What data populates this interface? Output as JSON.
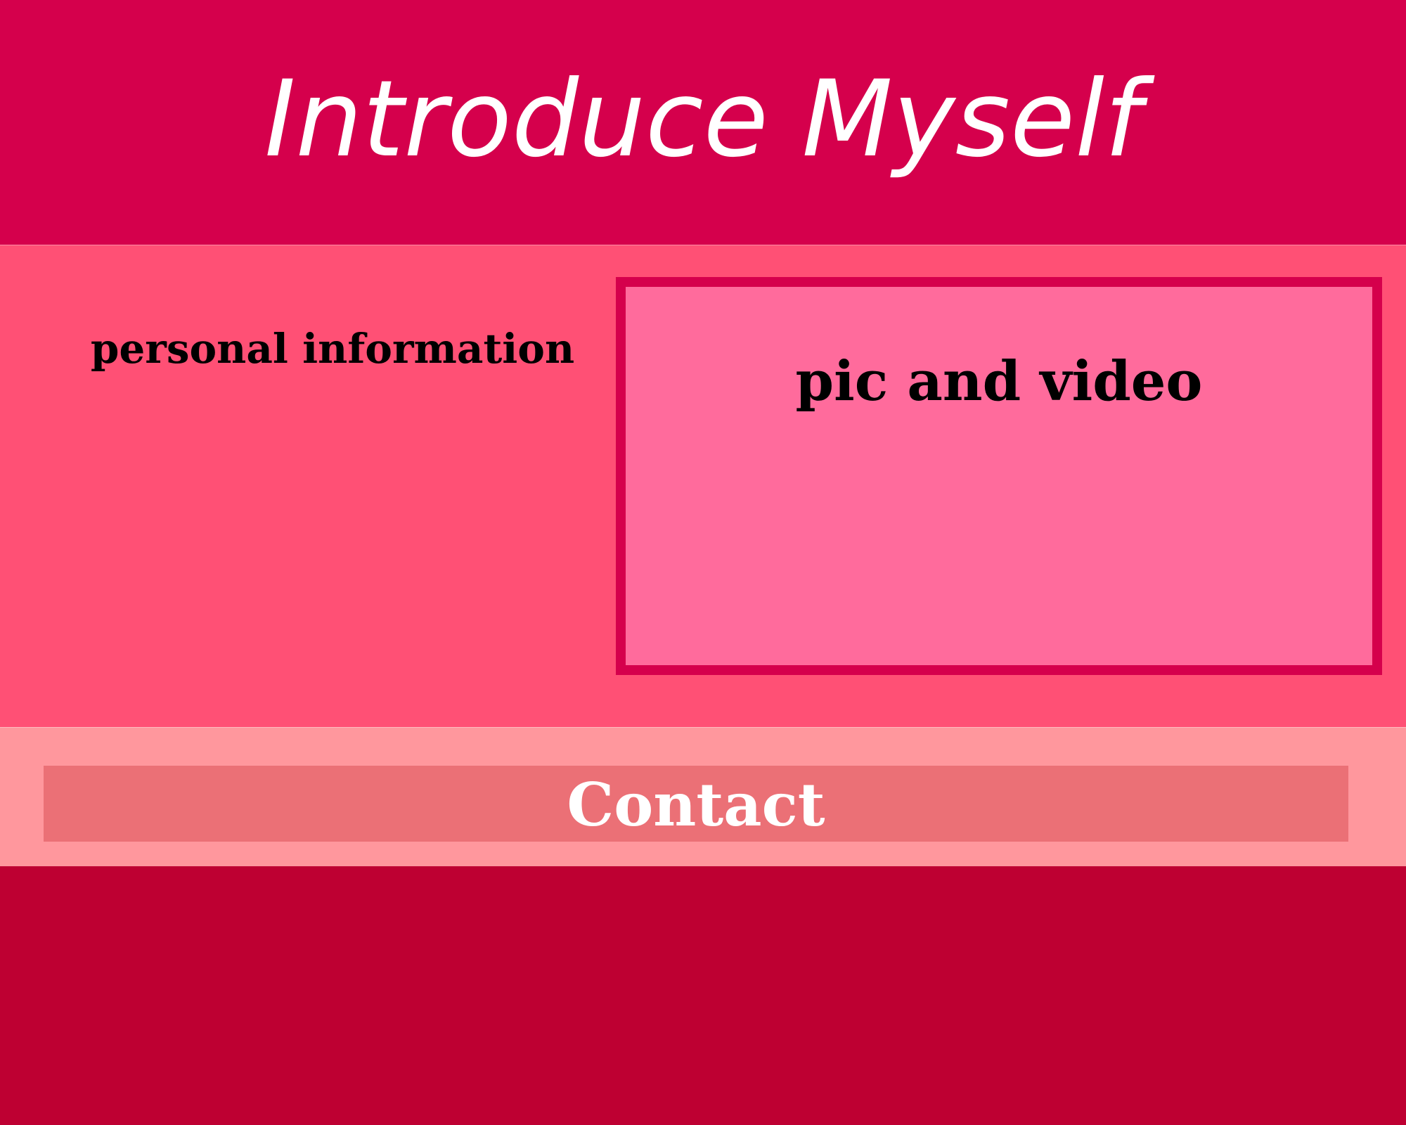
{
  "header": {
    "title": "Introduce Myself"
  },
  "main": {
    "personal_info_heading": "personal information",
    "media_heading": "pic and video"
  },
  "contact": {
    "label": "Contact"
  },
  "colors": {
    "header_bg": "#D5004C",
    "main_bg": "#FF5075",
    "media_box_bg": "#FF6B9C",
    "media_box_border": "#D5004C",
    "contact_band_bg": "#FF979D",
    "contact_bar_bg": "#EB7076",
    "footer_bg": "#BE0032",
    "title_text": "#FFFFFF",
    "heading_text": "#000000"
  }
}
